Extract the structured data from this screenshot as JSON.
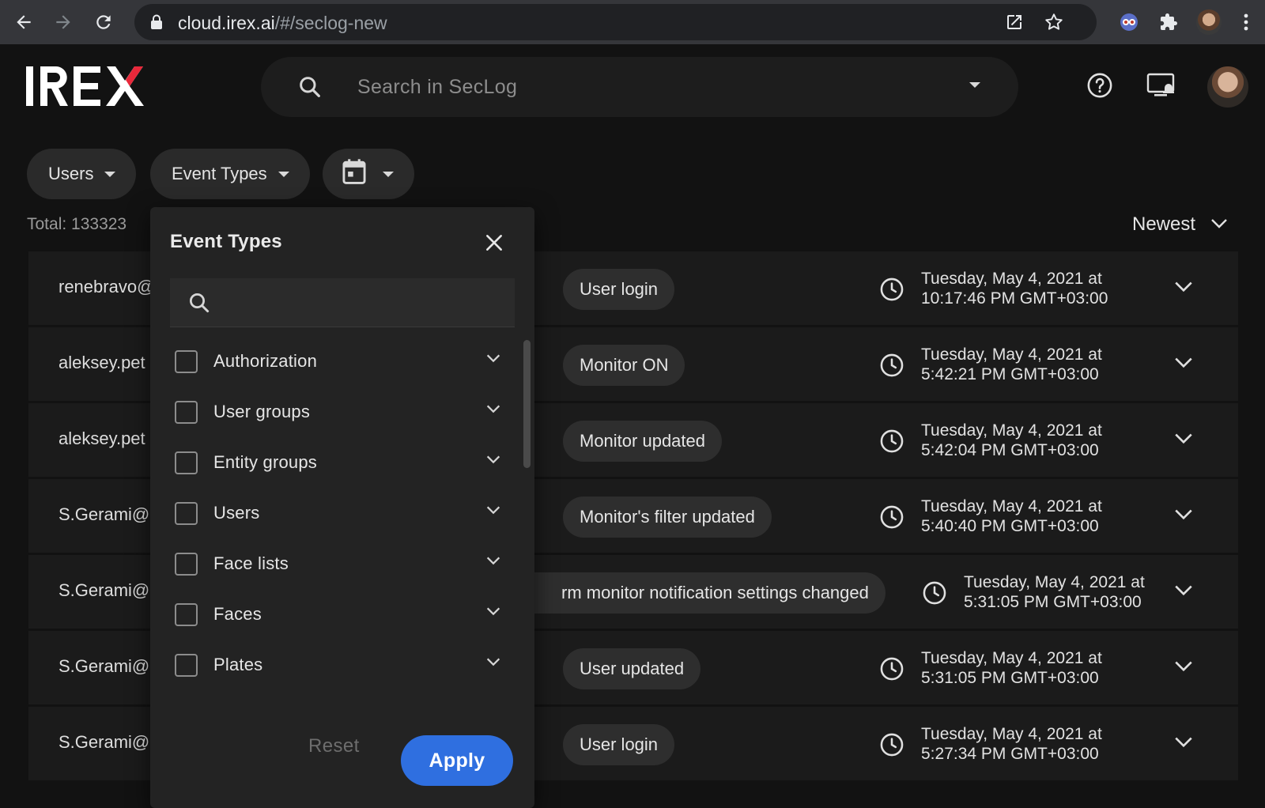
{
  "browser": {
    "url_host": "cloud.irex.ai",
    "url_path": "/#/seclog-new"
  },
  "app": {
    "logo_text": "IREX",
    "search": {
      "placeholder": "Search in SecLog"
    }
  },
  "filters": {
    "users_label": "Users",
    "event_types_label": "Event Types"
  },
  "list": {
    "total": "Total: 133323",
    "sort_label": "Newest",
    "rows": [
      {
        "user": "renebravo@",
        "event": "User login",
        "date_line1": "Tuesday, May 4, 2021 at",
        "date_line2": "10:17:46 PM GMT+03:00"
      },
      {
        "user": "aleksey.pet",
        "event": "Monitor ON",
        "date_line1": "Tuesday, May 4, 2021 at",
        "date_line2": "5:42:21 PM GMT+03:00"
      },
      {
        "user": "aleksey.pet",
        "event": "Monitor updated",
        "date_line1": "Tuesday, May 4, 2021 at",
        "date_line2": "5:42:04 PM GMT+03:00"
      },
      {
        "user": "S.Gerami@",
        "event": "Monitor's filter updated",
        "date_line1": "Tuesday, May 4, 2021 at",
        "date_line2": "5:40:40 PM GMT+03:00"
      },
      {
        "user": "S.Gerami@",
        "event": "rm monitor notification settings changed",
        "date_line1": "Tuesday, May 4, 2021 at",
        "date_line2": "5:31:05 PM GMT+03:00"
      },
      {
        "user": "S.Gerami@",
        "event": "User updated",
        "date_line1": "Tuesday, May 4, 2021 at",
        "date_line2": "5:31:05 PM GMT+03:00"
      },
      {
        "user": "S.Gerami@",
        "event": "User login",
        "date_line1": "Tuesday, May 4, 2021 at",
        "date_line2": "5:27:34 PM GMT+03:00"
      }
    ]
  },
  "event_types_panel": {
    "title": "Event Types",
    "search_value": "",
    "options": [
      {
        "label": "Authorization",
        "checked": false
      },
      {
        "label": "User groups",
        "checked": false
      },
      {
        "label": "Entity groups",
        "checked": false
      },
      {
        "label": "Users",
        "checked": false
      },
      {
        "label": "Face lists",
        "checked": false
      },
      {
        "label": "Faces",
        "checked": false
      },
      {
        "label": "Plates",
        "checked": false
      }
    ],
    "reset_label": "Reset",
    "apply_label": "Apply"
  },
  "colors": {
    "background": "#121212",
    "row": "#1b1b1b",
    "panel": "#232323",
    "accent": "#2f6fe0",
    "logo_accent": "#e8283a"
  },
  "icons": {
    "browser": [
      "back-arrow-icon",
      "forward-arrow-icon",
      "reload-icon",
      "lock-icon",
      "open-in-new-icon",
      "star-icon",
      "extension-icon",
      "puzzle-icon",
      "menu-kebab-icon"
    ],
    "header": [
      "search-icon",
      "chevron-down-icon",
      "help-icon",
      "monitor-alert-icon"
    ],
    "rows": [
      "clock-icon",
      "chevron-down-icon"
    ]
  }
}
